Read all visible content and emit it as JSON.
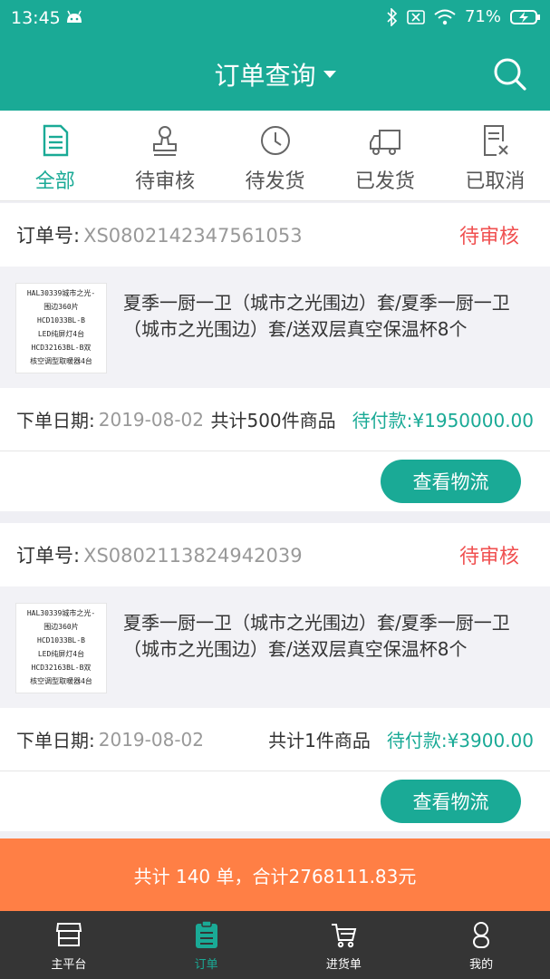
{
  "status_bar": {
    "time": "13:45",
    "battery": "71%"
  },
  "header": {
    "title": "订单查询"
  },
  "tabs": [
    {
      "label": "全部",
      "icon": "document-list-icon",
      "active": true
    },
    {
      "label": "待审核",
      "icon": "stamp-icon",
      "active": false
    },
    {
      "label": "待发货",
      "icon": "clock-icon",
      "active": false
    },
    {
      "label": "已发货",
      "icon": "truck-icon",
      "active": false
    },
    {
      "label": "已取消",
      "icon": "cancelled-doc-icon",
      "active": false
    }
  ],
  "orders": [
    {
      "order_label": "订单号:",
      "order_no": "XS0802142347561053",
      "status": "待审核",
      "thumb_lines": [
        "HAL30339城市之光-",
        "围边360片",
        "HCD1033BL-B",
        "LED纯屏灯4台",
        "HCD32163BL-B双",
        "核空调型取暖器4台"
      ],
      "product_name": "夏季一厨一卫（城市之光围边）套/夏季一厨一卫（城市之光围边）套/送双层真空保温杯8个",
      "date_label": "下单日期:",
      "date": "2019-08-02",
      "count_text": "共计500件商品",
      "payment_text": "待付款:¥1950000.00",
      "button_label": "查看物流"
    },
    {
      "order_label": "订单号:",
      "order_no": "XS0802113824942039",
      "status": "待审核",
      "thumb_lines": [
        "HAL30339城市之光-",
        "围边360片",
        "HCD1033BL-B",
        "LED纯屏灯4台",
        "HCD32163BL-B双",
        "核空调型取暖器4台"
      ],
      "product_name": "夏季一厨一卫（城市之光围边）套/夏季一厨一卫（城市之光围边）套/送双层真空保温杯8个",
      "date_label": "下单日期:",
      "date": "2019-08-02",
      "count_text": "共计1件商品",
      "payment_text": "待付款:¥3900.00",
      "button_label": "查看物流"
    }
  ],
  "summary": "共计 140 单，合计2768111.83元",
  "bottom_nav": [
    {
      "label": "主平台",
      "icon": "store-icon",
      "active": false
    },
    {
      "label": "订单",
      "icon": "clipboard-icon",
      "active": true
    },
    {
      "label": "进货单",
      "icon": "cart-icon",
      "active": false
    },
    {
      "label": "我的",
      "icon": "person-icon",
      "active": false
    }
  ],
  "colors": {
    "primary": "#1aaa96",
    "status_red": "#f05050",
    "summary_bg": "#ff7f45",
    "nav_bg": "#353535"
  }
}
